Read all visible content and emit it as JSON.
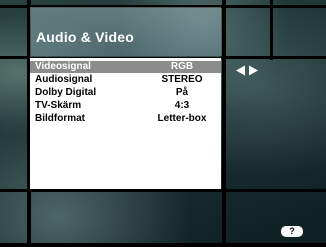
{
  "title": "Audio & Video",
  "menu": {
    "rows": [
      {
        "label": "Videosignal",
        "value": "RGB",
        "selected": true
      },
      {
        "label": "Audiosignal",
        "value": "STEREO",
        "selected": false
      },
      {
        "label": "Dolby Digital",
        "value": "På",
        "selected": false
      },
      {
        "label": "TV-Skärm",
        "value": "4:3",
        "selected": false
      },
      {
        "label": "Bildformat",
        "value": "Letter-box",
        "selected": false
      }
    ]
  },
  "nav_icon": "left-right-arrows-icon",
  "help": {
    "label": "?"
  },
  "colors": {
    "selected_row": "#8c8c8c",
    "menu_bg": "#ffffff",
    "grid": "#000000"
  }
}
